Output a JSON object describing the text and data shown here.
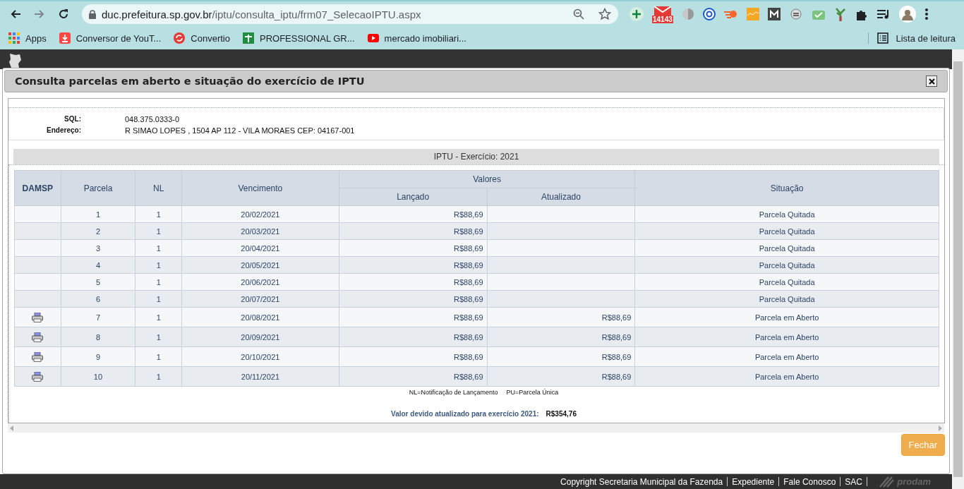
{
  "browser": {
    "url_host": "duc.prefeitura.sp.gov.br",
    "url_path": "/iptu/consulta_iptu/frm07_SelecaoIPTU.aspx",
    "mail_badge": "14143",
    "bookmarks": [
      "Apps",
      "Conversor de YouT...",
      "Convertio",
      "PROFESSIONAL GR...",
      "mercado imobiliari..."
    ],
    "reading_list": "Lista de leitura"
  },
  "dialog": {
    "title": "Consulta parcelas em aberto e situação do exercício de IPTU",
    "info": [
      {
        "label": "SQL:",
        "value": "048.375.0333-0"
      },
      {
        "label": "Endereço:",
        "value": "R SIMAO LOPES , 1504 AP 112 - VILA MORAES CEP: 04167-001"
      }
    ],
    "section_title": "IPTU - Exercício: 2021",
    "table": {
      "columns": [
        "DAMSP",
        "Parcela",
        "NL",
        "Vencimento",
        "Valores",
        "Situação"
      ],
      "subcolumns": [
        "Lançado",
        "Atualizado"
      ],
      "rows": [
        {
          "print": false,
          "parcela": "1",
          "nl": "1",
          "vencimento": "20/02/2021",
          "lancado": "R$88,69",
          "atualizado": "",
          "situacao": "Parcela Quitada"
        },
        {
          "print": false,
          "parcela": "2",
          "nl": "1",
          "vencimento": "20/03/2021",
          "lancado": "R$88,69",
          "atualizado": "",
          "situacao": "Parcela Quitada"
        },
        {
          "print": false,
          "parcela": "3",
          "nl": "1",
          "vencimento": "20/04/2021",
          "lancado": "R$88,69",
          "atualizado": "",
          "situacao": "Parcela Quitada"
        },
        {
          "print": false,
          "parcela": "4",
          "nl": "1",
          "vencimento": "20/05/2021",
          "lancado": "R$88,69",
          "atualizado": "",
          "situacao": "Parcela Quitada"
        },
        {
          "print": false,
          "parcela": "5",
          "nl": "1",
          "vencimento": "20/06/2021",
          "lancado": "R$88,69",
          "atualizado": "",
          "situacao": "Parcela Quitada"
        },
        {
          "print": false,
          "parcela": "6",
          "nl": "1",
          "vencimento": "20/07/2021",
          "lancado": "R$88,69",
          "atualizado": "",
          "situacao": "Parcela Quitada"
        },
        {
          "print": true,
          "parcela": "7",
          "nl": "1",
          "vencimento": "20/08/2021",
          "lancado": "R$88,69",
          "atualizado": "R$88,69",
          "situacao": "Parcela em Aberto"
        },
        {
          "print": true,
          "parcela": "8",
          "nl": "1",
          "vencimento": "20/09/2021",
          "lancado": "R$88,69",
          "atualizado": "R$88,69",
          "situacao": "Parcela em Aberto"
        },
        {
          "print": true,
          "parcela": "9",
          "nl": "1",
          "vencimento": "20/10/2021",
          "lancado": "R$88,69",
          "atualizado": "R$88,69",
          "situacao": "Parcela em Aberto"
        },
        {
          "print": true,
          "parcela": "10",
          "nl": "1",
          "vencimento": "20/11/2021",
          "lancado": "R$88,69",
          "atualizado": "R$88,69",
          "situacao": "Parcela em Aberto"
        }
      ]
    },
    "legend": [
      "NL=Notificação de Lançamento",
      "PU=Parcela Única"
    ],
    "total_label": "Valor devido atualizado para exercício 2021:",
    "total_value": "R$354,76",
    "close_button": "Fechar"
  },
  "footer": {
    "links": [
      "Copyright Secretaria Municipal da Fazenda",
      "Expediente",
      "Fale Conosco",
      "SAC"
    ],
    "logo": "prodam"
  }
}
